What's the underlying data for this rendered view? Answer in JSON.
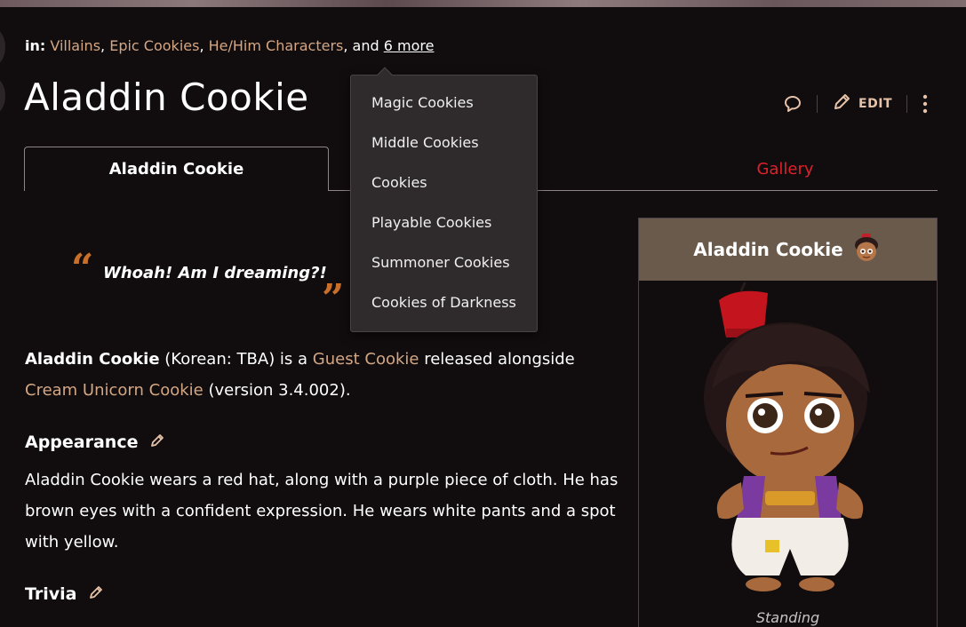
{
  "categories": {
    "prefix": "in:",
    "links": [
      "Villains",
      "Epic Cookies",
      "He/Him Characters"
    ],
    "and": ", and ",
    "more": "6 more"
  },
  "page": {
    "title": "Aladdin Cookie"
  },
  "actions": {
    "edit_label": "EDIT"
  },
  "tabs": {
    "active": "Aladdin Cookie",
    "gallery": "Gallery"
  },
  "quote": {
    "open": "“",
    "text": "Whoah! Am I dreaming?!",
    "close": "”"
  },
  "intro": {
    "name": "Aladdin Cookie",
    "text1": " (Korean: TBA) is a ",
    "link1": "Guest Cookie",
    "text2": " released alongside ",
    "link2": "Cream Unicorn Cookie",
    "text3": " (version 3.4.002)."
  },
  "sections": {
    "appearance": "Appearance",
    "appearance_text": "Aladdin Cookie wears a red hat, along with a purple piece of cloth. He has brown eyes with a confident expression. He wears white pants and a spot with yellow.",
    "trivia": "Trivia"
  },
  "dropdown": {
    "items": [
      "Magic Cookies",
      "Middle Cookies",
      "Cookies",
      "Playable Cookies",
      "Summoner Cookies",
      "Cookies of Darkness"
    ]
  },
  "infobox": {
    "title": "Aladdin Cookie",
    "caption": "Standing"
  },
  "colors": {
    "link": "#d3a784",
    "gallery_tab": "#e0202a",
    "quote_mark": "#c8702a",
    "infobox_header": "#6a5a4c"
  },
  "icons": [
    "comment-icon",
    "pencil-icon",
    "kebab-menu-icon",
    "edit-section-icon",
    "quote-icon",
    "cookie-head-icon"
  ]
}
